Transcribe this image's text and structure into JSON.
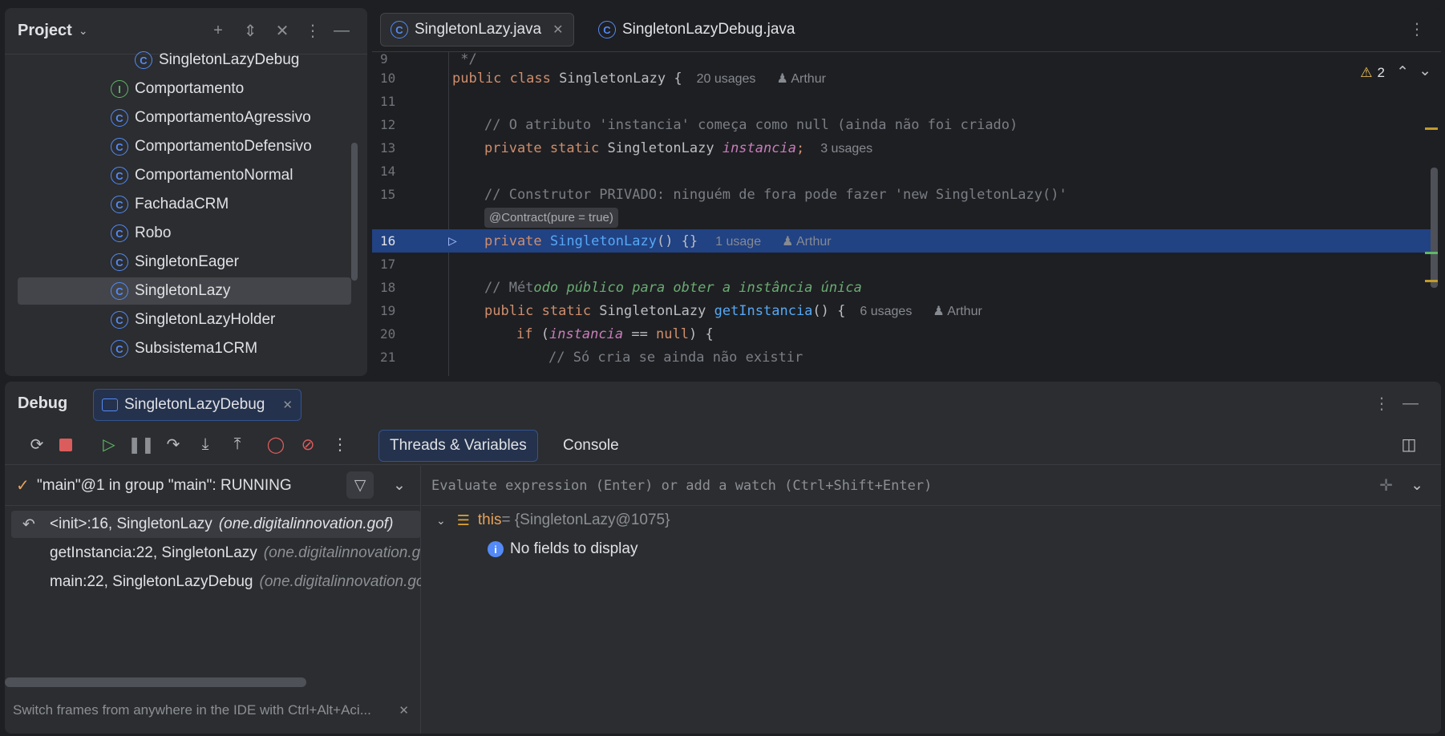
{
  "project": {
    "title": "Project",
    "items": [
      {
        "label": "SingletonLazyDebug",
        "icon": "class-debug-icon"
      },
      {
        "label": "Comportamento",
        "icon": "interface-icon"
      },
      {
        "label": "ComportamentoAgressivo",
        "icon": "class-icon"
      },
      {
        "label": "ComportamentoDefensivo",
        "icon": "class-icon"
      },
      {
        "label": "ComportamentoNormal",
        "icon": "class-icon"
      },
      {
        "label": "FachadaCRM",
        "icon": "class-icon"
      },
      {
        "label": "Robo",
        "icon": "class-icon"
      },
      {
        "label": "SingletonEager",
        "icon": "class-icon"
      },
      {
        "label": "SingletonLazy",
        "icon": "class-icon"
      },
      {
        "label": "SingletonLazyHolder",
        "icon": "class-icon"
      },
      {
        "label": "Subsistema1CRM",
        "icon": "class-icon"
      }
    ]
  },
  "editor": {
    "tabs": [
      {
        "label": "SingletonLazy.java"
      },
      {
        "label": "SingletonLazyDebug.java"
      }
    ],
    "warnings": "2",
    "lines": {
      "l9": {
        "n": "9",
        "t": " */"
      },
      "l10": {
        "n": "10",
        "a": "public class",
        "b": " SingletonLazy {",
        "usages": "20 usages",
        "author": "Arthur"
      },
      "l11": {
        "n": "11"
      },
      "l12": {
        "n": "12",
        "t": "// O atributo 'instancia' começa como null (ainda não foi criado)"
      },
      "l13": {
        "n": "13",
        "a": "private static",
        "b": " SingletonLazy ",
        "c": "instancia",
        "d": ";",
        "usages": "3 usages"
      },
      "l14": {
        "n": "14"
      },
      "l15": {
        "n": "15",
        "t": "// Construtor PRIVADO: ninguém de fora pode fazer 'new SingletonLazy()'"
      },
      "contract": "@Contract(pure = true)",
      "l16": {
        "n": "16",
        "a": "private",
        "b": "SingletonLazy",
        "c": "() {}",
        "usages": "1 usage",
        "author": "Arthur"
      },
      "l17": {
        "n": "17"
      },
      "l18": {
        "n": "18",
        "t1": "// Mét",
        "t2": "odo público para obter a instância única"
      },
      "l19": {
        "n": "19",
        "a": "public static",
        "b": " SingletonLazy ",
        "c": "getInstancia",
        "d": "() {",
        "usages": "6 usages",
        "author": "Arthur"
      },
      "l20": {
        "n": "20",
        "a": "if",
        "b": " (",
        "c": "instancia",
        "d": " == ",
        "e": "null",
        "f": ") {"
      },
      "l21": {
        "n": "21",
        "t": "// Só cria se ainda não existir"
      }
    }
  },
  "debug": {
    "title": "Debug",
    "session_tab": "SingletonLazyDebug",
    "view_tabs": [
      "Threads & Variables",
      "Console"
    ],
    "thread": "\"main\"@1 in group \"main\": RUNNING",
    "frames": [
      {
        "m": "<init>:16, SingletonLazy",
        "p": "(one.digitalinnovation.gof)"
      },
      {
        "m": "getInstancia:22, SingletonLazy",
        "p": "(one.digitalinnovation.gof)"
      },
      {
        "m": "main:22, SingletonLazyDebug",
        "p": "(one.digitalinnovation.gof)"
      }
    ],
    "eval_placeholder": "Evaluate expression (Enter) or add a watch (Ctrl+Shift+Enter)",
    "var_name": "this",
    "var_value": " = {SingletonLazy@1075}",
    "no_fields": "No fields to display",
    "hint": "Switch frames from anywhere in the IDE with Ctrl+Alt+Aci..."
  }
}
